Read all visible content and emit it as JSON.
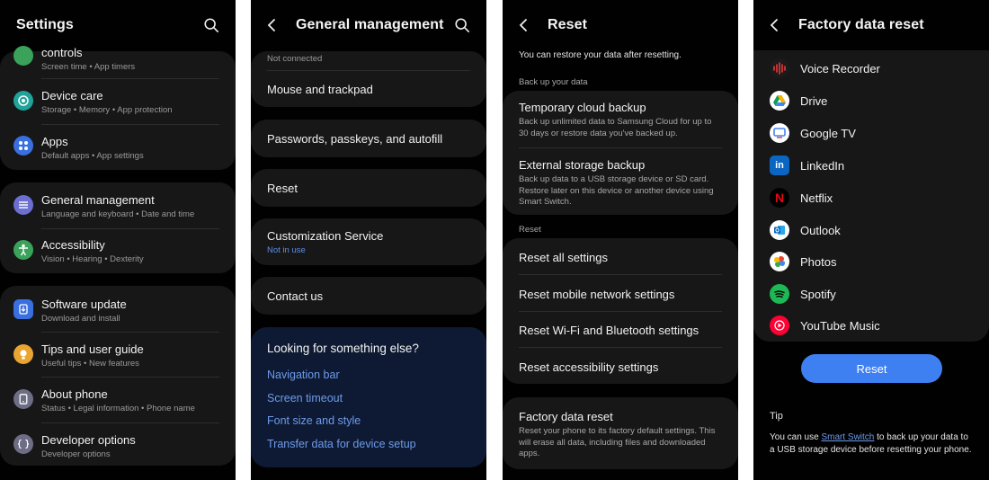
{
  "screen1": {
    "title": "Settings",
    "items": [
      {
        "title": "controls",
        "sub": "Screen time  •  App timers"
      },
      {
        "title": "Device care",
        "sub": "Storage  •  Memory  •  App protection"
      },
      {
        "title": "Apps",
        "sub": "Default apps  •  App settings"
      },
      {
        "title": "General management",
        "sub": "Language and keyboard  •  Date and time"
      },
      {
        "title": "Accessibility",
        "sub": "Vision  •  Hearing  •  Dexterity"
      },
      {
        "title": "Software update",
        "sub": "Download and install"
      },
      {
        "title": "Tips and user guide",
        "sub": "Useful tips  •  New features"
      },
      {
        "title": "About phone",
        "sub": "Status  •  Legal information  •  Phone name"
      },
      {
        "title": "Developer options",
        "sub": "Developer options"
      }
    ]
  },
  "screen2": {
    "title": "General management",
    "not_connected": "Not connected",
    "mouse": "Mouse and trackpad",
    "passwords": "Passwords, passkeys, and autofill",
    "reset": "Reset",
    "customization": "Customization Service",
    "customization_sub": "Not in use",
    "contact": "Contact us",
    "looking": "Looking for something else?",
    "links": [
      "Navigation bar",
      "Screen timeout",
      "Font size and style",
      "Transfer data for device setup"
    ]
  },
  "screen3": {
    "title": "Reset",
    "intro": "You can restore your data after resetting.",
    "backup_label": "Back up your data",
    "temp_title": "Temporary cloud backup",
    "temp_desc": "Back up unlimited data to Samsung Cloud for up to 30 days or restore data you've backed up.",
    "ext_title": "External storage backup",
    "ext_desc": "Back up data to a USB storage device or SD card. Restore later on this device or another device using Smart Switch.",
    "reset_label": "Reset",
    "reset_items": [
      "Reset all settings",
      "Reset mobile network settings",
      "Reset Wi-Fi and Bluetooth settings",
      "Reset accessibility settings"
    ],
    "factory_title": "Factory data reset",
    "factory_desc": "Reset your phone to its factory default settings. This will erase all data, including files and downloaded apps."
  },
  "screen4": {
    "title": "Factory data reset",
    "apps": [
      "Voice Recorder",
      "Drive",
      "Google TV",
      "LinkedIn",
      "Netflix",
      "Outlook",
      "Photos",
      "Spotify",
      "YouTube Music"
    ],
    "reset_button": "Reset",
    "tip_label": "Tip",
    "tip_pre": "You can use ",
    "tip_link": "Smart Switch",
    "tip_post": " to back up your data to a USB storage device before resetting your phone."
  },
  "colors": {
    "accent": "#3e7ff2",
    "link": "#6d9bea",
    "card": "#171717",
    "background": "#010101"
  },
  "icons": [
    "search-icon",
    "back-arrow-icon",
    "device-care-icon",
    "apps-icon",
    "general-management-icon",
    "accessibility-icon",
    "software-update-icon",
    "tips-icon",
    "about-phone-icon",
    "developer-options-icon"
  ]
}
